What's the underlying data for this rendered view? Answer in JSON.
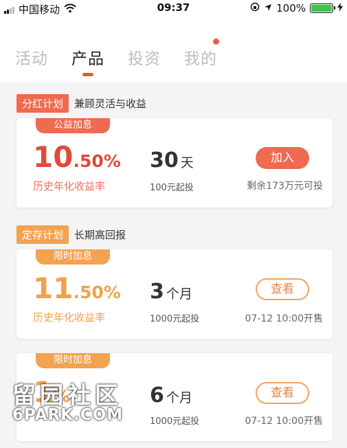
{
  "status_bar": {
    "carrier": "中国移动",
    "time": "09:37",
    "battery_pct": "100%",
    "icons": [
      "signal-icon",
      "wifi-icon",
      "lock-rotation-icon",
      "location-icon",
      "battery-icon",
      "charging-icon"
    ]
  },
  "tabs": [
    {
      "label": "活动",
      "active": false
    },
    {
      "label": "产品",
      "active": true
    },
    {
      "label": "投资",
      "active": false
    },
    {
      "label": "我的",
      "active": false,
      "notification_dot": true
    }
  ],
  "sections": [
    {
      "badge": "分红计划",
      "badge_color": "#ef6a4f",
      "subtitle": "兼顾灵活与收益"
    },
    {
      "badge": "定存计划",
      "badge_color": "#f3a24f",
      "subtitle": "长期高回报"
    }
  ],
  "cards": [
    {
      "ribbon": "公益加息",
      "ribbon_color": "#ef6a4f",
      "rate_int": "10",
      "rate_dec": ".50%",
      "rate_color": "#e04a3b",
      "rate_label": "历史年化收益率",
      "term_num": "30",
      "term_unit": "天",
      "min_invest": "100元起投",
      "button": "加入",
      "button_style": "solid",
      "note": "剩余173万元可投"
    },
    {
      "ribbon": "限时加息",
      "ribbon_color": "#f3a24f",
      "rate_int": "11",
      "rate_dec": ".50%",
      "rate_color": "#f0a24a",
      "rate_label": "历史年化收益率",
      "term_num": "3",
      "term_unit": "个月",
      "min_invest": "1000元起投",
      "button": "查看",
      "button_style": "outline",
      "note": "07-12 10:00开售"
    },
    {
      "ribbon": "限时加息",
      "ribbon_color": "#f3a24f",
      "rate_int": "1",
      "rate_dec": "%",
      "rate_color": "#f0a24a",
      "term_num": "6",
      "term_unit": "个月",
      "min_invest": "1000元起投",
      "button": "查看",
      "button_style": "outline",
      "note": "07-12 10:00开售"
    }
  ],
  "watermark": {
    "line1": "留园社区",
    "line2": "6PARK.COM"
  }
}
